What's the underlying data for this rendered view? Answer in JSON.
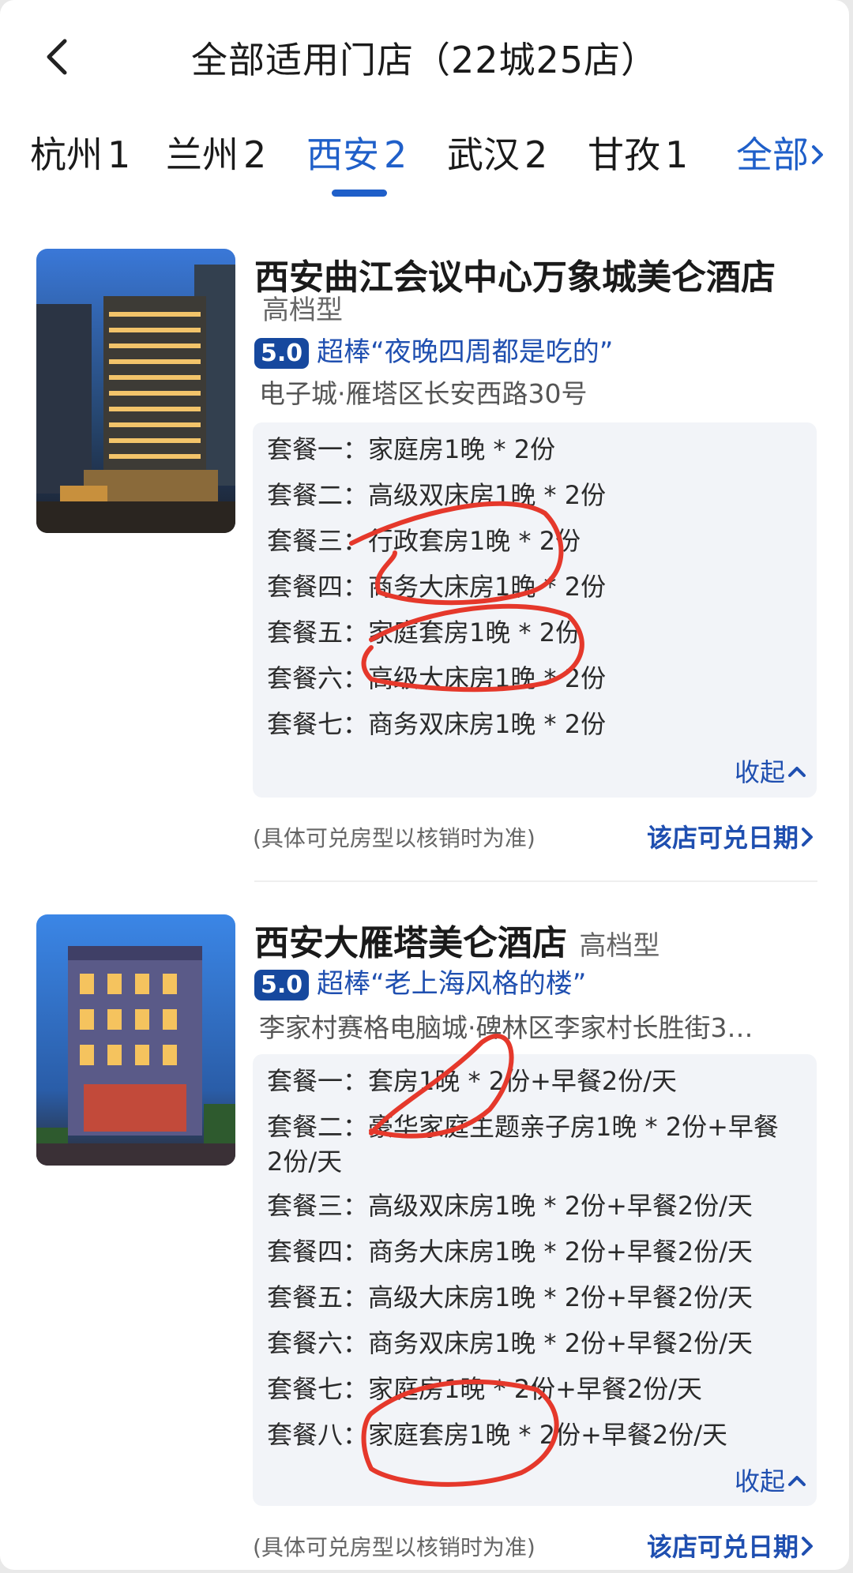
{
  "header": {
    "title": "全部适用门店（22城25店）"
  },
  "tabs": [
    {
      "city": "杭州",
      "count": "1"
    },
    {
      "city": "兰州",
      "count": "2"
    },
    {
      "city": "西安",
      "count": "2"
    },
    {
      "city": "武汉",
      "count": "2"
    },
    {
      "city": "甘孜",
      "count": "1"
    }
  ],
  "tab_all": {
    "label": "全部"
  },
  "hotels": [
    {
      "name": "西安曲江会议中心万象城美仑酒店",
      "type": "高档型",
      "score": "5.0",
      "review": "超棒“夜晚四周都是吃的”",
      "address": "电子城·雁塔区长安西路30号",
      "packages": [
        "套餐一：家庭房1晚 * 2份",
        "套餐二：高级双床房1晚 * 2份",
        "套餐三：行政套房1晚 * 2份",
        "套餐四：商务大床房1晚 * 2份",
        "套餐五：家庭套房1晚 * 2份",
        "套餐六：高级大床房1晚 * 2份",
        "套餐七：商务双床房1晚 * 2份"
      ],
      "collapse_label": "收起",
      "note": "(具体可兑房型以核销时为准)",
      "dates_label": "该店可兑日期"
    },
    {
      "name": "西安大雁塔美仑酒店",
      "type": "高档型",
      "score": "5.0",
      "review": "超棒“老上海风格的楼”",
      "address": "李家村赛格电脑城·碑林区李家村长胜街3…",
      "packages": [
        "套餐一：套房1晚 * 2份+早餐2份/天",
        "套餐二：豪华家庭主题亲子房1晚 * 2份+早餐2份/天",
        "套餐三：高级双床房1晚 * 2份+早餐2份/天",
        "套餐四：商务大床房1晚 * 2份+早餐2份/天",
        "套餐五：高级大床房1晚 * 2份+早餐2份/天",
        "套餐六：商务双床房1晚 * 2份+早餐2份/天",
        "套餐七：家庭房1晚 * 2份+早餐2份/天",
        "套餐八：家庭套房1晚 * 2份+早餐2份/天"
      ],
      "collapse_label": "收起",
      "note": "(具体可兑房型以核销时为准)",
      "dates_label": "该店可兑日期"
    }
  ],
  "colors": {
    "accent": "#1f5fc9",
    "score_badge": "#16489e",
    "markup": "#e5382b",
    "package_bg": "#f2f4f8"
  }
}
